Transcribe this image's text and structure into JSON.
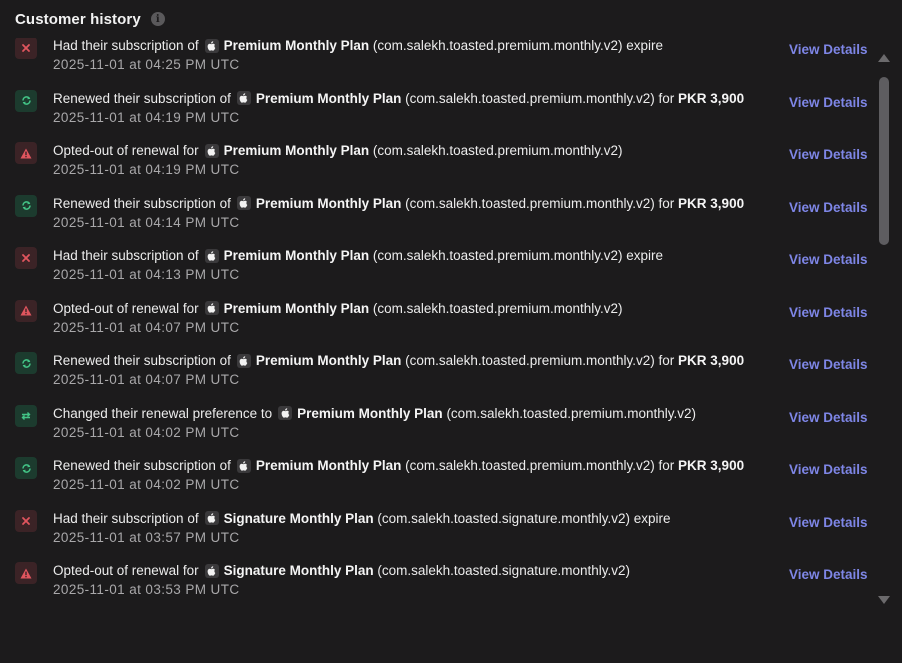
{
  "panel": {
    "title": "Customer history",
    "info_icon": "info-icon"
  },
  "events": [
    {
      "type": "expire",
      "icon": "close-icon",
      "prefix": "Had their subscription of",
      "plan": "Premium Monthly Plan",
      "product_id": "(com.salekh.toasted.premium.monthly.v2)",
      "suffix": "expire",
      "amount": "",
      "timestamp": "2025-11-01 at 04:25 PM UTC",
      "link": "View Details"
    },
    {
      "type": "renew",
      "icon": "renew-icon",
      "prefix": "Renewed their subscription of",
      "plan": "Premium Monthly Plan",
      "product_id": "(com.salekh.toasted.premium.monthly.v2)",
      "suffix": "for",
      "amount": "PKR 3,900",
      "timestamp": "2025-11-01 at 04:19 PM UTC",
      "link": "View Details"
    },
    {
      "type": "optout",
      "icon": "warning-icon",
      "prefix": "Opted-out of renewal for",
      "plan": "Premium Monthly Plan",
      "product_id": "(com.salekh.toasted.premium.monthly.v2)",
      "suffix": "",
      "amount": "",
      "timestamp": "2025-11-01 at 04:19 PM UTC",
      "link": "View Details"
    },
    {
      "type": "renew",
      "icon": "renew-icon",
      "prefix": "Renewed their subscription of",
      "plan": "Premium Monthly Plan",
      "product_id": "(com.salekh.toasted.premium.monthly.v2)",
      "suffix": "for",
      "amount": "PKR 3,900",
      "timestamp": "2025-11-01 at 04:14 PM UTC",
      "link": "View Details"
    },
    {
      "type": "expire",
      "icon": "close-icon",
      "prefix": "Had their subscription of",
      "plan": "Premium Monthly Plan",
      "product_id": "(com.salekh.toasted.premium.monthly.v2)",
      "suffix": "expire",
      "amount": "",
      "timestamp": "2025-11-01 at 04:13 PM UTC",
      "link": "View Details"
    },
    {
      "type": "optout",
      "icon": "warning-icon",
      "prefix": "Opted-out of renewal for",
      "plan": "Premium Monthly Plan",
      "product_id": "(com.salekh.toasted.premium.monthly.v2)",
      "suffix": "",
      "amount": "",
      "timestamp": "2025-11-01 at 04:07 PM UTC",
      "link": "View Details"
    },
    {
      "type": "renew",
      "icon": "renew-icon",
      "prefix": "Renewed their subscription of",
      "plan": "Premium Monthly Plan",
      "product_id": "(com.salekh.toasted.premium.monthly.v2)",
      "suffix": "for",
      "amount": "PKR 3,900",
      "timestamp": "2025-11-01 at 04:07 PM UTC",
      "link": "View Details"
    },
    {
      "type": "change",
      "icon": "swap-arrows-icon",
      "prefix": "Changed their renewal preference to",
      "plan": "Premium Monthly Plan",
      "product_id": "(com.salekh.toasted.premium.monthly.v2)",
      "suffix": "",
      "amount": "",
      "timestamp": "2025-11-01 at 04:02 PM UTC",
      "link": "View Details"
    },
    {
      "type": "renew",
      "icon": "renew-icon",
      "prefix": "Renewed their subscription of",
      "plan": "Premium Monthly Plan",
      "product_id": "(com.salekh.toasted.premium.monthly.v2)",
      "suffix": "for",
      "amount": "PKR 3,900",
      "timestamp": "2025-11-01 at 04:02 PM UTC",
      "link": "View Details"
    },
    {
      "type": "expire",
      "icon": "close-icon",
      "prefix": "Had their subscription of",
      "plan": "Signature Monthly Plan",
      "product_id": "(com.salekh.toasted.signature.monthly.v2)",
      "suffix": "expire",
      "amount": "",
      "timestamp": "2025-11-01 at 03:57 PM UTC",
      "link": "View Details"
    },
    {
      "type": "optout",
      "icon": "warning-icon",
      "prefix": "Opted-out of renewal for",
      "plan": "Signature Monthly Plan",
      "product_id": "(com.salekh.toasted.signature.monthly.v2)",
      "suffix": "",
      "amount": "",
      "timestamp": "2025-11-01 at 03:53 PM UTC",
      "link": "View Details"
    }
  ],
  "colors": {
    "background": "#1c1b1c",
    "link": "#7e86e6",
    "success": "#43c486",
    "danger": "#e0555e"
  }
}
